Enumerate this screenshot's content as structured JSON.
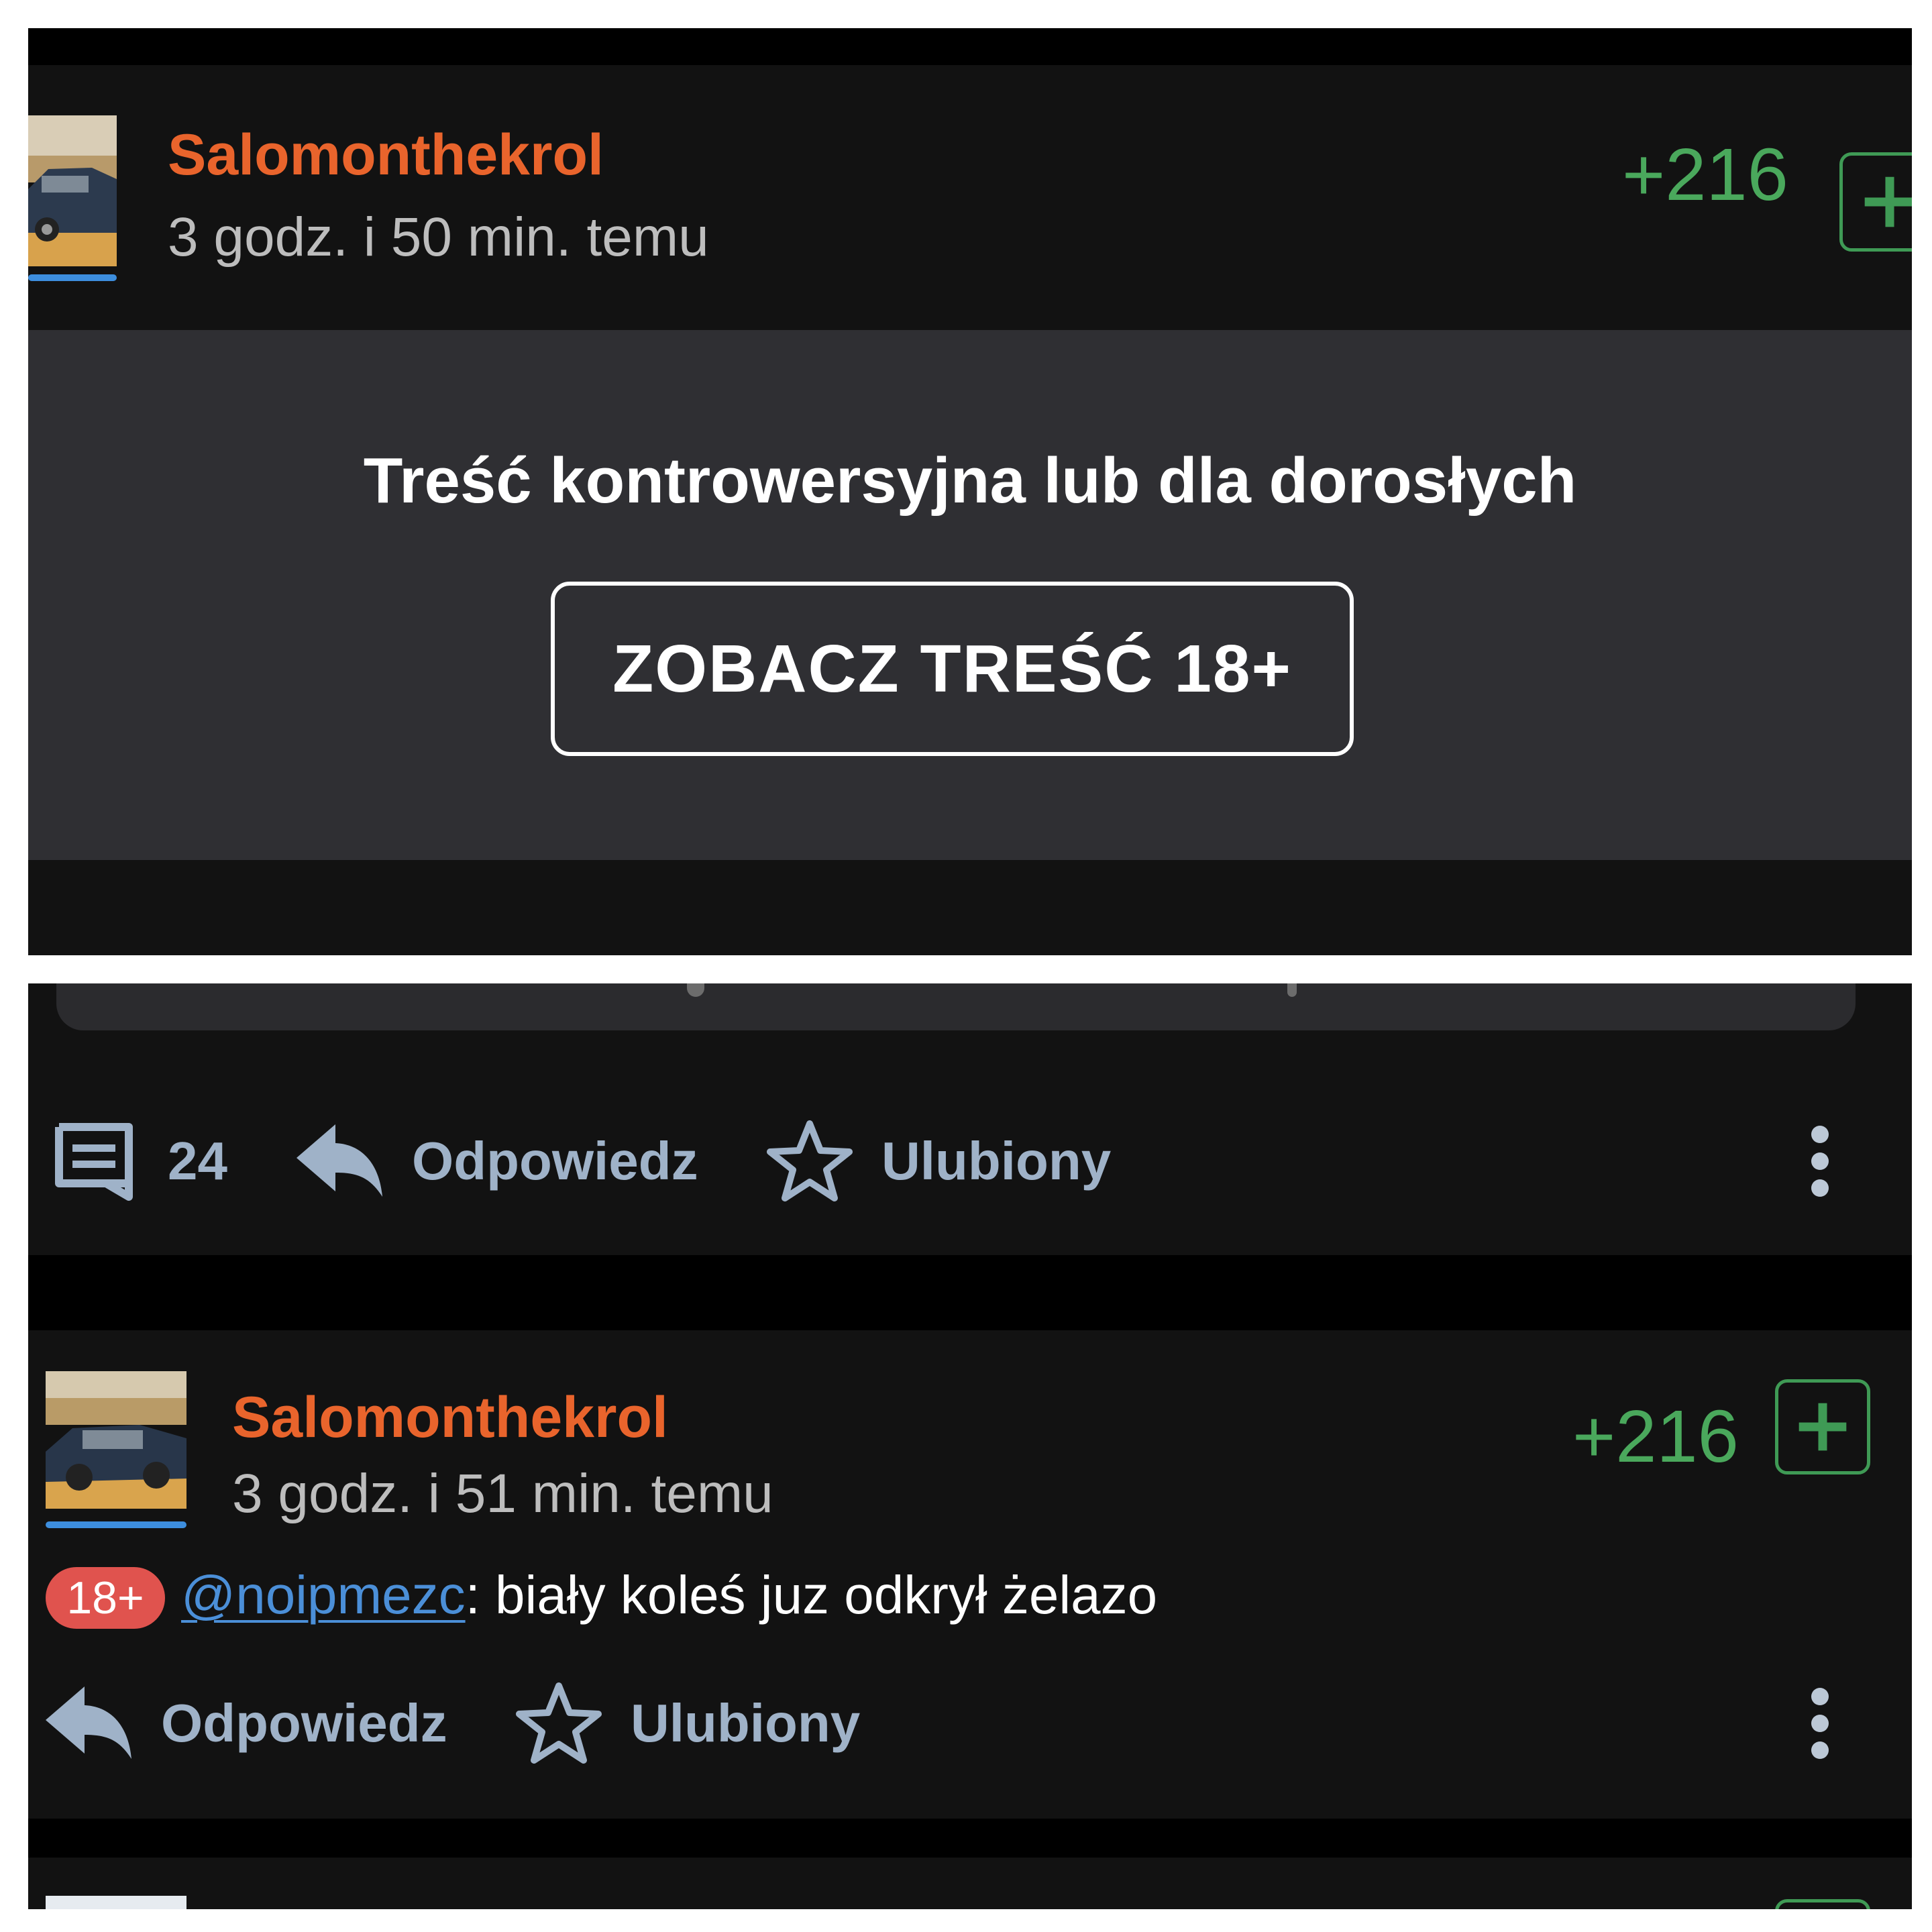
{
  "top_post": {
    "username": "Salomonthekrol",
    "timestamp": "3 godz. i 50 min. temu",
    "score": "+216",
    "nsfw": {
      "title": "Treść kontrowersyjna lub dla dorosłych",
      "button_label": "ZOBACZ TREŚĆ 18+"
    }
  },
  "actions_row": {
    "comment_count": "24",
    "reply_label": "Odpowiedz",
    "favorite_label": "Ulubiony"
  },
  "comment": {
    "username": "Salomonthekrol",
    "timestamp": "3 godz. i 51 min. temu",
    "score": "+216",
    "badge": "18+",
    "mention": "@noipmezc",
    "text": ": biały koleś juz odkrył żelazo",
    "reply_label": "Odpowiedz",
    "favorite_label": "Ulubiony"
  },
  "colors": {
    "username": "#e9642c",
    "score": "#4aa85c",
    "action": "#9fb2c8",
    "mention": "#4b8fd8",
    "badge": "#e0534e"
  }
}
